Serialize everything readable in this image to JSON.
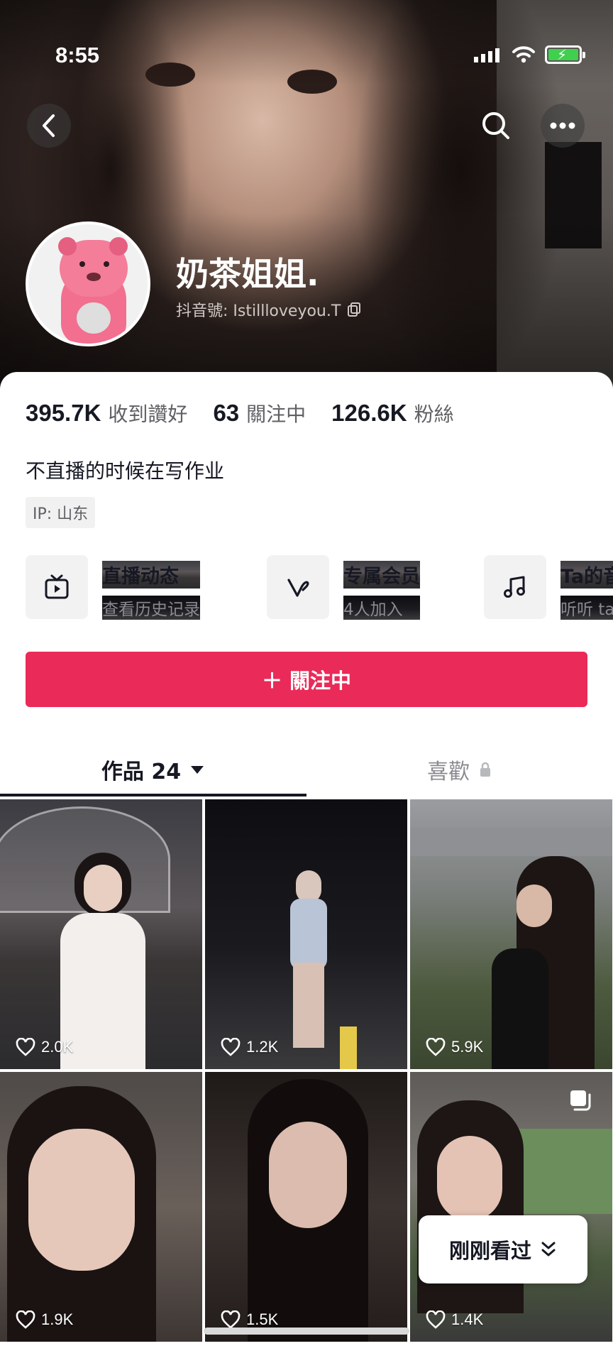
{
  "status_bar": {
    "time": "8:55"
  },
  "profile": {
    "name": "奶茶姐姐.",
    "handle": "抖音號: Istillloveyou.T",
    "bio": "不直播的时候在写作业",
    "ip": "IP: 山东"
  },
  "stats": [
    {
      "value": "395.7K",
      "label": "收到讚好"
    },
    {
      "value": "63",
      "label": "關注中"
    },
    {
      "value": "126.6K",
      "label": "粉絲"
    }
  ],
  "shortcuts": [
    {
      "title": "直播动态",
      "subtitle": "查看历史记录",
      "icon": "tv-icon"
    },
    {
      "title": "专属会员",
      "subtitle": "4人加入",
      "icon": "v-heart-icon"
    },
    {
      "title": "Ta的音",
      "subtitle": "听听 ta",
      "icon": "music-note-icon"
    }
  ],
  "follow_button": {
    "label": "＋ 關注中"
  },
  "tabs": {
    "works": "作品 24",
    "likes": "喜歡"
  },
  "videos": [
    {
      "likes": "2.0K"
    },
    {
      "likes": "1.2K"
    },
    {
      "likes": "5.9K"
    },
    {
      "likes": "1.9K"
    },
    {
      "likes": "1.5K"
    },
    {
      "likes": "1.4K"
    }
  ],
  "recent_button": {
    "label": "刚刚看过"
  },
  "colors": {
    "accent": "#ea2a58",
    "text_primary": "#161823",
    "text_secondary": "#8a8b91"
  }
}
